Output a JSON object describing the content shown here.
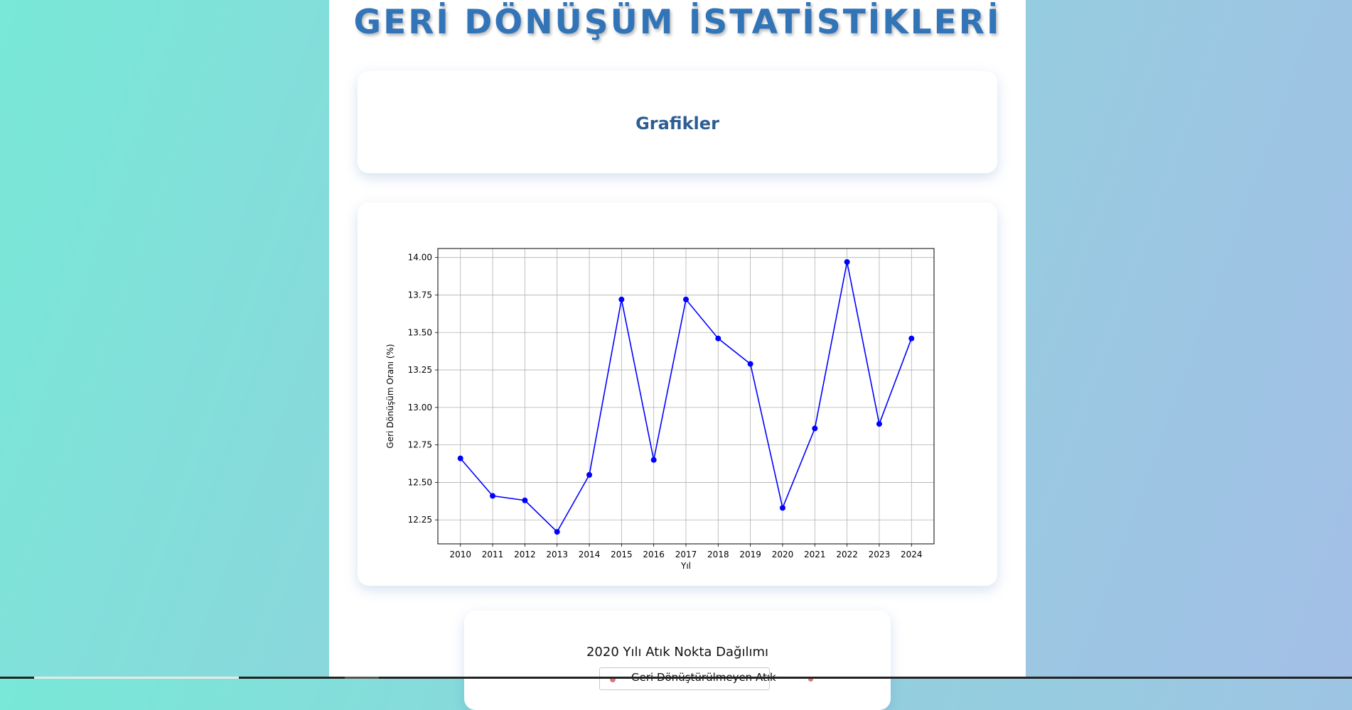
{
  "page": {
    "title": "GERİ DÖNÜŞÜM İSTATİSTİKLERİ",
    "section_heading": "Grafikler"
  },
  "chart_data": [
    {
      "type": "line",
      "title": "",
      "xlabel": "Yıl",
      "ylabel": "Geri Dönüşüm Oranı (%)",
      "x": [
        2010,
        2011,
        2012,
        2013,
        2014,
        2015,
        2016,
        2017,
        2018,
        2019,
        2020,
        2021,
        2022,
        2023,
        2024
      ],
      "y": [
        12.66,
        12.41,
        12.38,
        12.17,
        12.55,
        13.72,
        12.65,
        13.72,
        13.46,
        13.29,
        12.33,
        12.86,
        13.97,
        12.89,
        13.46
      ],
      "ylim": [
        12.09,
        14.06
      ],
      "yticks": [
        "12.25",
        "12.50",
        "12.75",
        "13.00",
        "13.25",
        "13.50",
        "13.75",
        "14.00"
      ],
      "xticks": [
        "2010",
        "2011",
        "2012",
        "2013",
        "2014",
        "2015",
        "2016",
        "2017",
        "2018",
        "2019",
        "2020",
        "2021",
        "2022",
        "2023",
        "2024"
      ],
      "grid": true,
      "color": "#0000ff"
    },
    {
      "type": "scatter",
      "title": "2020 Yılı Atık Nokta Dağılımı",
      "legend": [
        "Geri Dönüştürülmeyen Atık"
      ],
      "color": "#e57373"
    }
  ]
}
